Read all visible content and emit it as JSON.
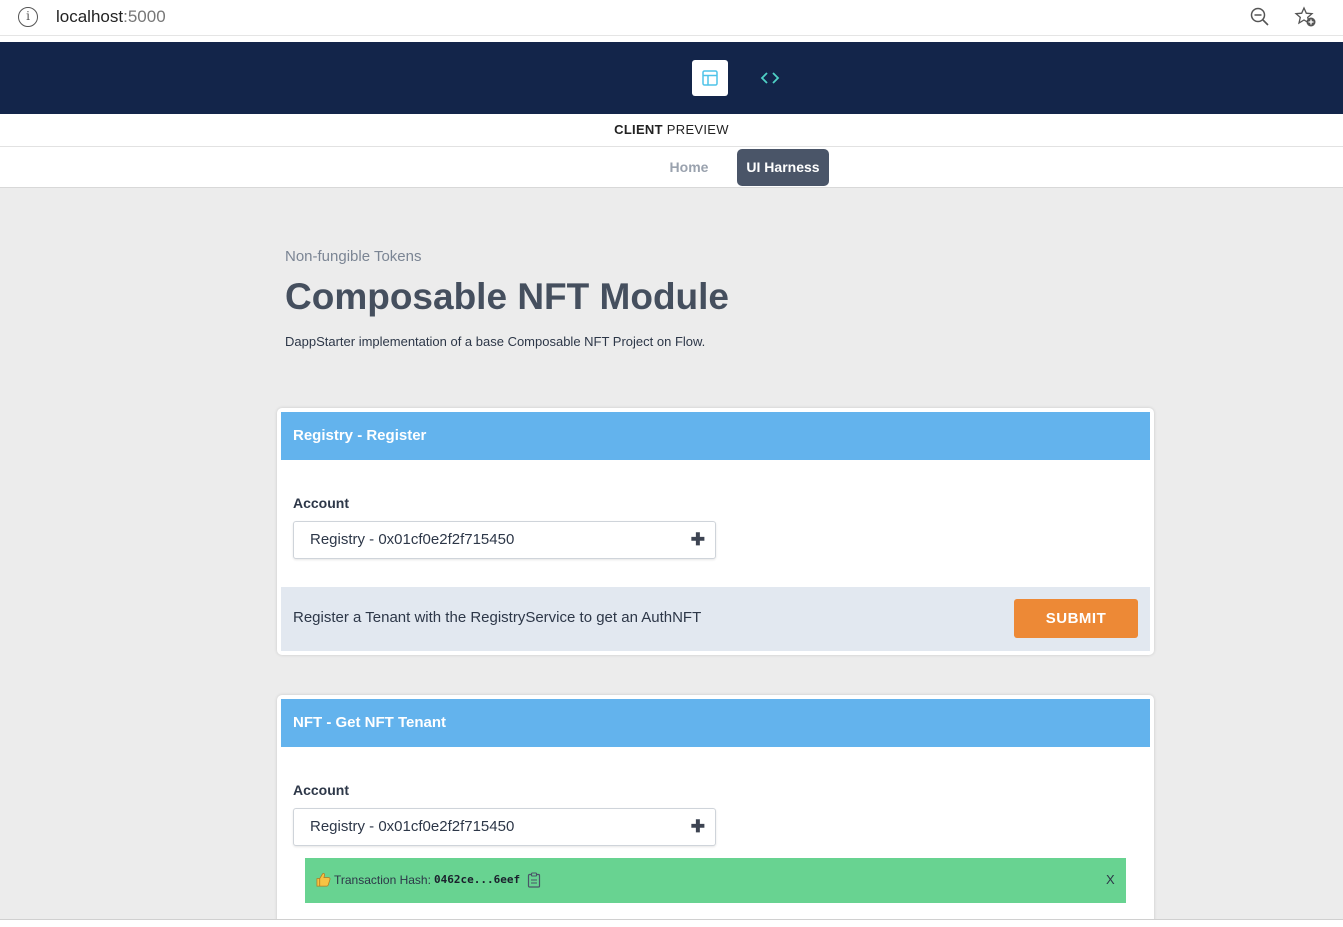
{
  "browser": {
    "url_host": "localhost",
    "url_port": ":5000",
    "info_icon": "info-icon",
    "zoom_icon": "zoom-out-icon",
    "favorite_icon": "add-favorite-icon"
  },
  "toolbar": {
    "layout_icon": "layout-icon",
    "code_icon": "code-icon"
  },
  "preview": {
    "strong": "CLIENT",
    "rest": "PREVIEW"
  },
  "nav": {
    "items": [
      {
        "label": "Home",
        "active": false
      },
      {
        "label": "UI Harness",
        "active": true
      }
    ]
  },
  "header": {
    "eyebrow": "Non-fungible Tokens",
    "title": "Composable NFT Module",
    "description": "DappStarter implementation of a base Composable NFT Project on Flow."
  },
  "cards": [
    {
      "title": "Registry - Register",
      "account_label": "Account",
      "account_value": "Registry - 0x01cf0e2f2f715450",
      "action_text": "Register a Tenant with the RegistryService to get an AuthNFT",
      "submit_label": "SUBMIT"
    },
    {
      "title": "NFT - Get NFT Tenant",
      "account_label": "Account",
      "account_value": "Registry - 0x01cf0e2f2f715450",
      "transaction": {
        "label": "Transaction Hash:",
        "hash": "0462ce...6eef",
        "close": "X"
      }
    }
  ],
  "colors": {
    "header_bg": "#13254a",
    "card_header": "#63b3ed",
    "submit": "#ed8936",
    "success": "#68d391",
    "nav_active": "#4a5568"
  }
}
